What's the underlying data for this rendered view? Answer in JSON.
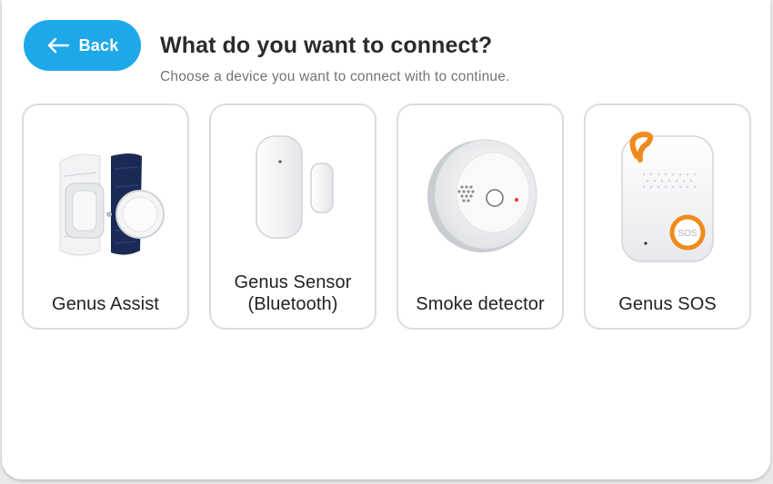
{
  "header": {
    "back_label": "Back",
    "title": "What do you want to connect?",
    "subtitle": "Choose a device you want to connect with to continue."
  },
  "devices": [
    {
      "label": "Genus Assist",
      "icon": "wristband-icon"
    },
    {
      "label": "Genus Sensor (Bluetooth)",
      "icon": "door-sensor-icon"
    },
    {
      "label": "Smoke detector",
      "icon": "smoke-detector-icon"
    },
    {
      "label": "Genus SOS",
      "icon": "sos-pendant-icon"
    }
  ],
  "colors": {
    "accent": "#1da8ea",
    "sos_orange": "#f08a1c",
    "card_border": "#dcdcdc",
    "wristband_navy": "#1b2a55"
  }
}
